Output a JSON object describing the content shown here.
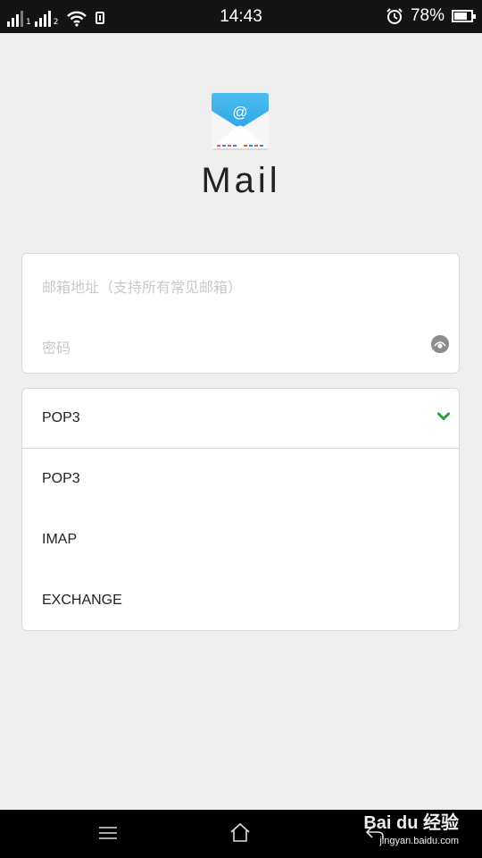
{
  "status_bar": {
    "time": "14:43",
    "battery_percent": "78%",
    "sim1_label": "1",
    "sim2_label": "2",
    "battery_level": 0.78,
    "icons": [
      "signal-icon",
      "signal-icon",
      "wifi-icon",
      "sim-card-icon",
      "alarm-icon",
      "battery-icon"
    ]
  },
  "app": {
    "title": "Mail",
    "logo_icon": "mail-envelope-icon",
    "accent_color": "#42b4ec"
  },
  "login": {
    "email_placeholder": "邮箱地址（支持所有常见邮箱）",
    "password_placeholder": "密码",
    "toggle_icon": "eye-icon"
  },
  "protocol": {
    "selected": "POP3",
    "options": [
      "POP3",
      "IMAP",
      "EXCHANGE"
    ],
    "check_color": "#2a9d3c"
  },
  "nav_bar": {
    "icons": [
      "menu-icon",
      "home-icon",
      "back-icon"
    ]
  },
  "watermark": {
    "brand": "Bai du 经验",
    "url": "jingyan.baidu.com"
  }
}
